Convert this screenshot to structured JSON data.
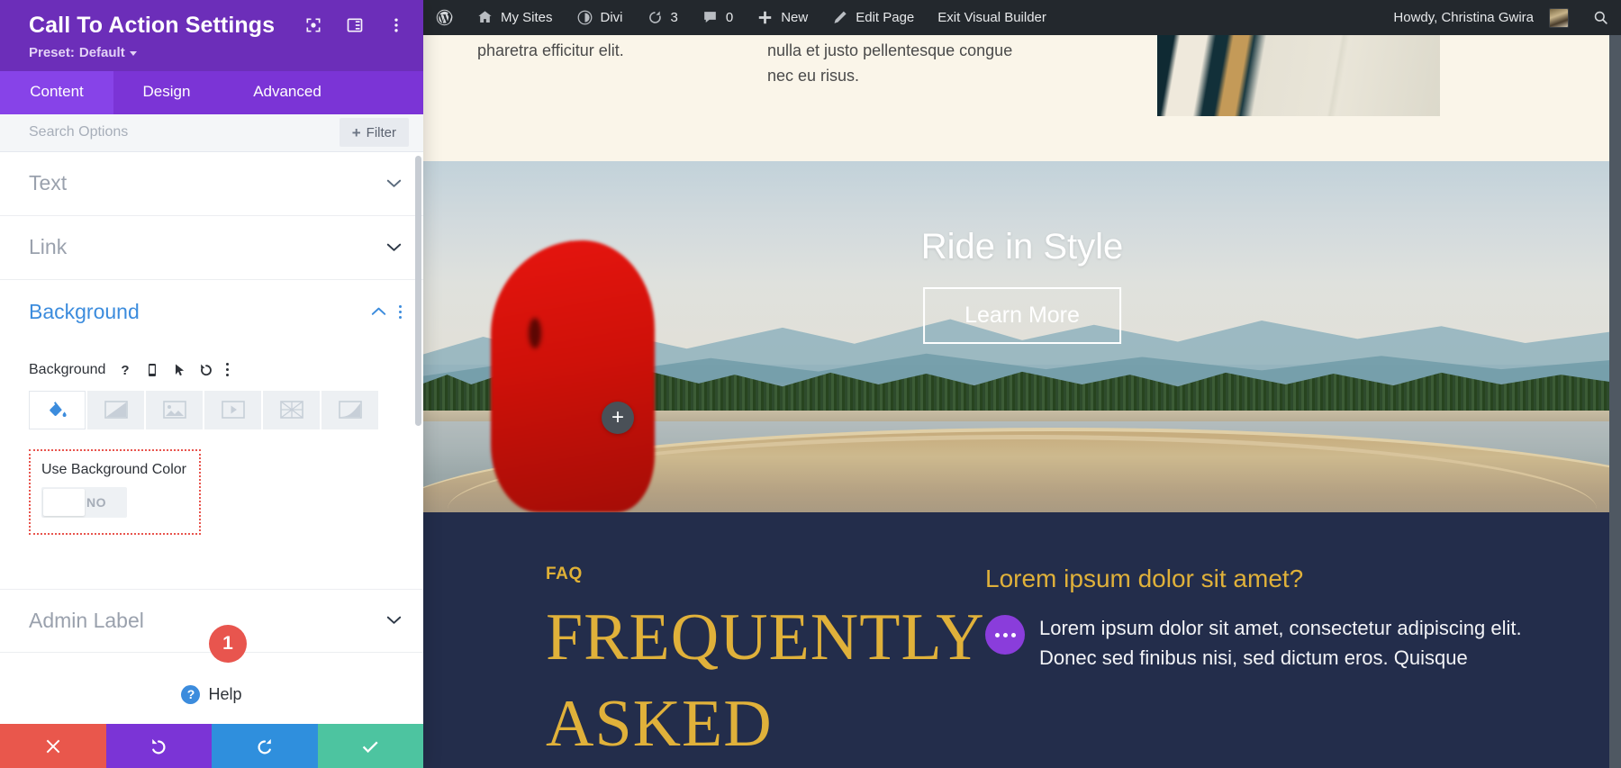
{
  "settings_panel": {
    "title": "Call To Action Settings",
    "preset": {
      "label": "Preset:",
      "value": "Default"
    },
    "header_icons": [
      {
        "name": "focus-target-icon"
      },
      {
        "name": "layout-panel-icon"
      },
      {
        "name": "vertical-dots-icon"
      }
    ],
    "tabs": [
      {
        "label": "Content",
        "active": true
      },
      {
        "label": "Design",
        "active": false
      },
      {
        "label": "Advanced",
        "active": false
      }
    ],
    "search": {
      "placeholder": "Search Options",
      "value": ""
    },
    "filter_button": {
      "label": "Filter",
      "icon": "plus-icon"
    },
    "sections": [
      {
        "label": "Text",
        "state": "collapsed"
      },
      {
        "label": "Link",
        "state": "collapsed"
      },
      {
        "label": "Background",
        "state": "expanded"
      },
      {
        "label": "Admin Label",
        "state": "collapsed"
      }
    ],
    "background_option": {
      "label": "Background",
      "control_icons": [
        "help-icon",
        "responsive-phone-icon",
        "hover-cursor-icon",
        "reset-undo-icon",
        "vertical-dots-icon"
      ],
      "type_tabs": [
        {
          "name": "background-color-tab",
          "icon": "paint-bucket-icon",
          "active": true
        },
        {
          "name": "background-gradient-tab",
          "icon": "gradient-icon",
          "active": false
        },
        {
          "name": "background-image-tab",
          "icon": "image-icon",
          "active": false
        },
        {
          "name": "background-video-tab",
          "icon": "video-icon",
          "active": false
        },
        {
          "name": "background-pattern-tab",
          "icon": "pattern-icon",
          "active": false
        },
        {
          "name": "background-mask-tab",
          "icon": "mask-icon",
          "active": false
        }
      ],
      "toggle": {
        "label": "Use Background Color",
        "value": "NO",
        "on": false
      },
      "highlight_badge": "1"
    },
    "help": {
      "label": "Help",
      "icon": "question-icon"
    },
    "actions": [
      {
        "name": "cancel-button",
        "icon": "close-x-icon",
        "color": "#e9574c"
      },
      {
        "name": "undo-button",
        "icon": "undo-arrow-icon",
        "color": "#7b34d6"
      },
      {
        "name": "redo-button",
        "icon": "redo-arrow-icon",
        "color": "#2f8fdd"
      },
      {
        "name": "save-button",
        "icon": "check-icon",
        "color": "#4dc4a0"
      }
    ]
  },
  "admin_bar": {
    "items": [
      {
        "name": "wordpress-logo",
        "label": "",
        "icon": "wordpress-icon"
      },
      {
        "name": "my-sites",
        "label": "My Sites",
        "icon": "sites-house-icon"
      },
      {
        "name": "divi",
        "label": "Divi",
        "icon": "divi-icon"
      },
      {
        "name": "updates",
        "label": "3",
        "icon": "update-refresh-icon"
      },
      {
        "name": "comments",
        "label": "0",
        "icon": "comment-bubble-icon"
      },
      {
        "name": "new",
        "label": "New",
        "icon": "plus-icon"
      },
      {
        "name": "edit-page",
        "label": "Edit Page",
        "icon": "pencil-icon"
      },
      {
        "name": "exit-visual-builder",
        "label": "Exit Visual Builder",
        "icon": ""
      }
    ],
    "howdy": "Howdy, Christina Gwira",
    "search_icon": "search-icon"
  },
  "preview": {
    "text_band": {
      "left_column": "pharetra efficitur elit.",
      "right_column": "nulla et justo pellentesque congue nec eu risus."
    },
    "hero": {
      "title": "Ride in Style",
      "button_label": "Learn More",
      "add_module_icon": "plus-circle-icon"
    },
    "faq": {
      "eyebrow": "FAQ",
      "heading_line1": "FREQUENTLY",
      "heading_line2": "ASKED",
      "question": "Lorem ipsum dolor sit amet?",
      "answer": "Lorem ipsum dolor sit amet, consectetur adipiscing elit. Donec sed finibus nisi, sed dictum eros. Quisque"
    }
  },
  "colors": {
    "panel_header": "#6c2eb9",
    "tab_active": "#8743e8",
    "accent_blue": "#3c8cdd",
    "highlight_red": "#e8554e",
    "faq_bg": "#232d4b",
    "faq_gold": "#e0b13a",
    "admin_bar": "#23282d"
  }
}
